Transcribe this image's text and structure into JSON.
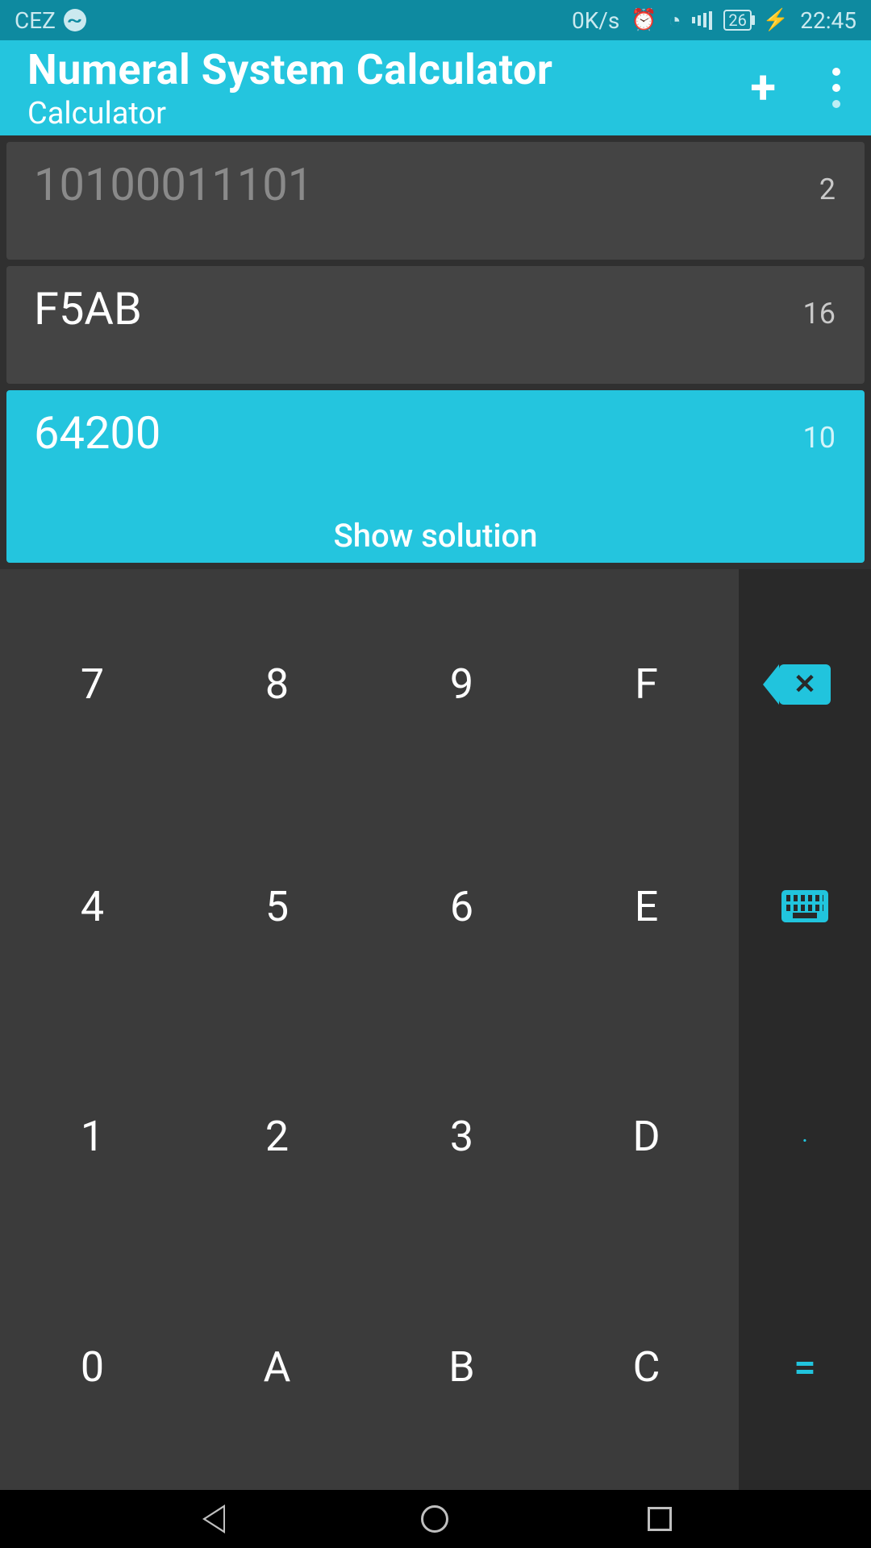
{
  "status": {
    "carrier": "CEZ",
    "speed": "0K/s",
    "battery": "26",
    "time": "22:45"
  },
  "appbar": {
    "title": "Numeral System Calculator",
    "subtitle": "Calculator"
  },
  "cards": [
    {
      "value": "10100011101",
      "base": "2",
      "state": "faded"
    },
    {
      "value": "F5AB",
      "base": "16",
      "state": "normal"
    },
    {
      "value": "64200",
      "base": "10",
      "state": "active"
    }
  ],
  "show_solution_label": "Show solution",
  "keypad": {
    "rows": [
      [
        "7",
        "8",
        "9",
        "F"
      ],
      [
        "4",
        "5",
        "6",
        "E"
      ],
      [
        "1",
        "2",
        "3",
        "D"
      ],
      [
        "0",
        "A",
        "B",
        "C"
      ]
    ],
    "side": {
      "decimal_point": ".",
      "equals": "="
    }
  }
}
